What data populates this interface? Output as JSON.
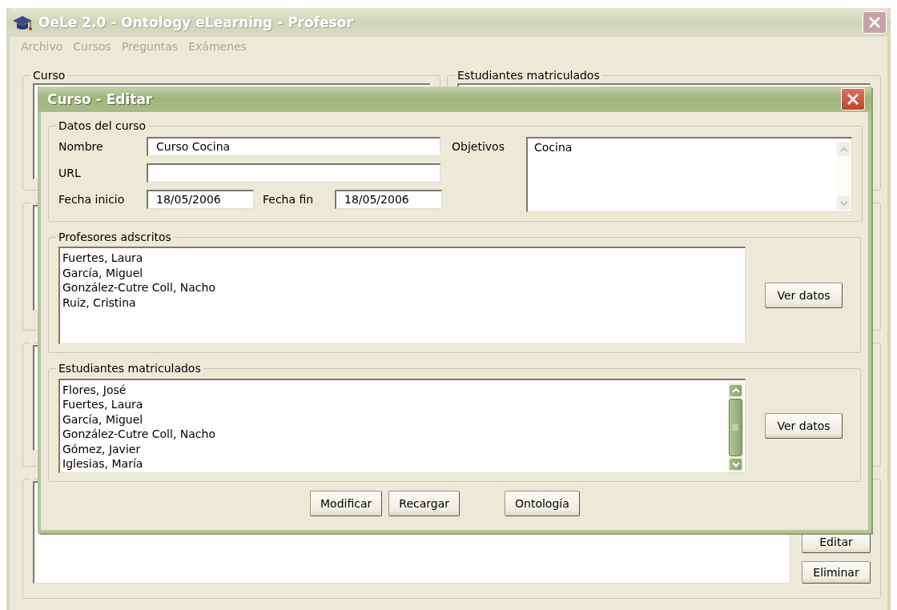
{
  "window": {
    "title": "OeLe 2.0 - Ontology eLearning - Profesor"
  },
  "menu": [
    {
      "label": "Archivo"
    },
    {
      "label": "Cursos"
    },
    {
      "label": "Preguntas"
    },
    {
      "label": "Exámenes"
    }
  ],
  "background": {
    "groups": [
      {
        "title": "Curso"
      },
      {
        "title": "Estudiantes matriculados"
      }
    ],
    "buttons": [
      "Editar",
      "Eliminar"
    ]
  },
  "dialog": {
    "title": "Curso - Editar",
    "course_data": {
      "title": "Datos del curso",
      "fields": [
        {
          "kind": "text",
          "label": "Nombre",
          "value": "Curso Cocina"
        },
        {
          "kind": "text",
          "label": "URL"
        },
        {
          "kind": "date",
          "label": "Fecha inicio",
          "value": "18/05/2006"
        },
        {
          "kind": "date",
          "label": "Fecha fin",
          "value": "18/05/2006"
        }
      ],
      "objectives": {
        "label": "Objetivos",
        "value": "Cocina",
        "scroll_enabled": false
      }
    },
    "teachers": {
      "title": "Profesores adscritos",
      "items": [
        "Fuertes, Laura",
        "García, Miguel",
        "González-Cutre Coll, Nacho",
        "Ruiz, Cristina"
      ],
      "button": "Ver datos"
    },
    "students": {
      "title": "Estudiantes matriculados",
      "items": [
        "Flores, José",
        "Fuertes, Laura",
        "García, Miguel",
        "González-Cutre Coll, Nacho",
        "Gómez, Javier",
        "Iglesias, María"
      ],
      "button": "Ver datos",
      "scroll_enabled": true
    },
    "buttons": [
      "Modificar",
      "Recargar",
      "Ontología"
    ]
  }
}
